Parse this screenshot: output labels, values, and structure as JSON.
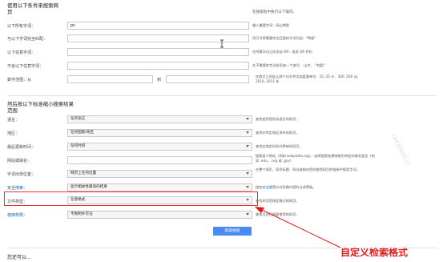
{
  "sections": {
    "find_pages_title": "使用以下条件来搜索网页",
    "find_pages_hint": "在搜索框中执行以下操作。",
    "narrow_title": "然后按以下标准缩小搜索结果范围",
    "you_can_title": "您还可以..."
  },
  "fields": [
    {
      "label": "以下所有字词：",
      "value": "ps",
      "tip": "输入重要字词：砀山鸭梨"
    },
    {
      "label": "与以下字词完全匹配：",
      "value": "",
      "tip": "用引号将需要完全匹配的字词引起：\"鸭梨\""
    },
    {
      "label": "以下任意字词：",
      "value": "",
      "tip": "在所需字词之间添加 OR：批发 OR 特价"
    },
    {
      "label": "不含以下任意字词：",
      "value": "",
      "tip": "在不需要的字词前添加一个减号：-山大、-\"刺梨\""
    }
  ],
  "numbers": {
    "label": "数字范围：从",
    "to": "到",
    "tip": "在数字之间加上两个句号并添加度量单位：10..35 斤、300..500 元、2010..2011 年"
  },
  "filters": [
    {
      "label": "语言：",
      "value": "任何语言",
      "tip": "查找使用您所选语言的网页。",
      "kind": "select",
      "blue": false
    },
    {
      "label": "地区：",
      "value": "任何国家/地区",
      "tip": "查找在特定地区发布的网页。",
      "kind": "select",
      "blue": false
    },
    {
      "label": "最后更新时间：",
      "value": "任何时间",
      "tip": "查找在指定时间内更新的网页。",
      "kind": "select",
      "blue": false
    },
    {
      "label": "网站或域名：",
      "value": "",
      "tip": "搜索某个网站（例如 wikipedia.org），或将搜索结果限制为特定的域名类型（例如 .edu、.org 或 .gov）",
      "kind": "input",
      "blue": false
    },
    {
      "label": "字词出现位置：",
      "value": "网页上任何位置",
      "tip": "在整个网页、网页标题、网址或指向您所查找网页的链接中搜索字词。",
      "kind": "select",
      "blue": false
    },
    {
      "label": "安全搜索：",
      "value": "显示相关性最高的结果",
      "tip": "指定安全搜索针对色情内容的过滤等级。",
      "tip_link": "安全搜索",
      "kind": "select",
      "blue": true
    },
    {
      "label": "文件类型：",
      "value": "任意格式",
      "tip": "查找采用您指定格式的网页。",
      "kind": "select",
      "blue": false
    },
    {
      "label": "使用权限：",
      "value": "不限制许可证",
      "tip": "查找可自己随意使用的网页。",
      "kind": "select",
      "blue": true
    }
  ],
  "search_button": "高级搜索",
  "annotation": "自定义检索格式",
  "watermark": "1443069027",
  "colors": {
    "accent_blue": "#4a8af4",
    "annotation_red": "#e01818",
    "link_blue": "#1a5fb4"
  }
}
